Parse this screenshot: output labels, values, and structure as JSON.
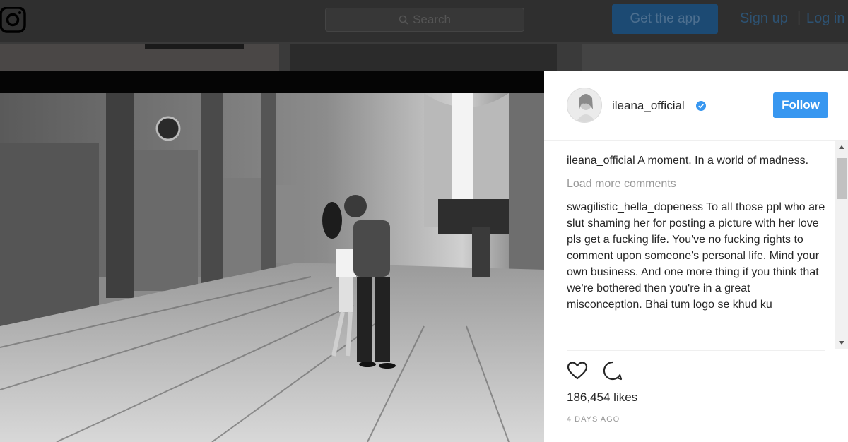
{
  "header": {
    "search_placeholder": "Search",
    "get_app_label": "Get the app",
    "signup_label": "Sign up",
    "separator": "|",
    "login_label": "Log in"
  },
  "post": {
    "username": "ileana_official",
    "follow_label": "Follow",
    "caption": {
      "username": "ileana_official",
      "text": "A moment. In a world of madness."
    },
    "load_more_label": "Load more comments",
    "comments": [
      {
        "username": "swagilistic_hella_dopeness",
        "text": "To all those ppl who are slut shaming her for posting a picture with her love pls get a fucking life. You've no fucking rights to comment upon someone's personal life. Mind your own business. And one more thing if you think that we're bothered then you're in a great misconception. Bhai tum logo se khud ku"
      }
    ],
    "likes_text": "186,454 likes",
    "timestamp": "4 DAYS AGO"
  },
  "icons": {
    "logo": "instagram-logo-icon",
    "search": "search-icon",
    "verified": "verified-badge-icon",
    "like": "heart-icon",
    "comment": "comment-icon"
  },
  "colors": {
    "accent": "#3897f0",
    "text": "#262626",
    "muted": "#999999"
  }
}
